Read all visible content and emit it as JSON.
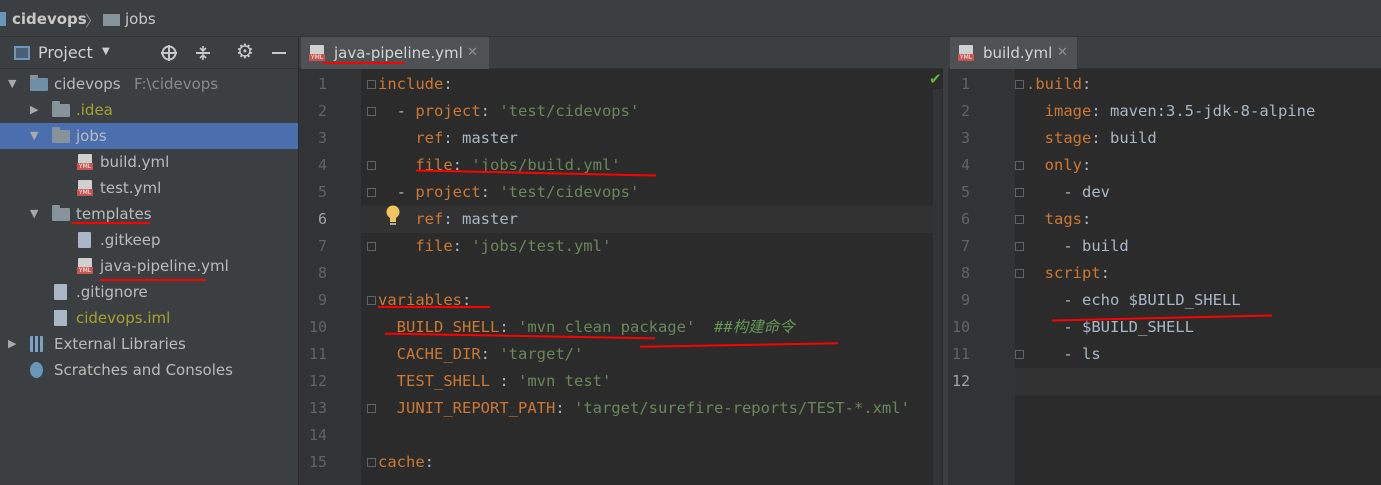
{
  "breadcrumb": {
    "root": "cidevops",
    "sep": "〉",
    "folder": "jobs"
  },
  "project_panel": {
    "header": {
      "view_label": "Project"
    },
    "tree": [
      {
        "label": "cidevops",
        "path": "F:\\cidevops",
        "kind": "module",
        "arrow": "▼",
        "level": 0
      },
      {
        "label": ".idea",
        "kind": "folder",
        "arrow": "▶",
        "level": 1,
        "color": "#a4a32f"
      },
      {
        "label": "jobs",
        "kind": "folder",
        "arrow": "▼",
        "level": 1,
        "selected": true
      },
      {
        "label": "build.yml",
        "kind": "yml",
        "level": 2
      },
      {
        "label": "test.yml",
        "kind": "yml",
        "level": 2
      },
      {
        "label": "templates",
        "kind": "folder",
        "arrow": "▼",
        "level": 1
      },
      {
        "label": ".gitkeep",
        "kind": "file",
        "level": 2
      },
      {
        "label": "java-pipeline.yml",
        "kind": "yml",
        "level": 2
      },
      {
        "label": ".gitignore",
        "kind": "file",
        "level": 1
      },
      {
        "label": "cidevops.iml",
        "kind": "file",
        "level": 1,
        "color": "#a4a32f"
      },
      {
        "label": "External Libraries",
        "kind": "lib",
        "arrow": "▶",
        "level": 0
      },
      {
        "label": "Scratches and Consoles",
        "kind": "scratch",
        "level": 0
      }
    ]
  },
  "editor_left": {
    "tab": {
      "label": "java-pipeline.yml",
      "close": "✕"
    },
    "current_line": 6,
    "lines": [
      {
        "n": "1",
        "t": [
          [
            "k",
            "include"
          ],
          [
            "p",
            ":"
          ]
        ]
      },
      {
        "n": "2",
        "t": [
          [
            "p",
            "  - "
          ],
          [
            "k",
            "project"
          ],
          [
            "p",
            ": "
          ],
          [
            "s",
            "'test/cidevops'"
          ]
        ]
      },
      {
        "n": "3",
        "t": [
          [
            "p",
            "    "
          ],
          [
            "k",
            "ref"
          ],
          [
            "p",
            ": master"
          ]
        ]
      },
      {
        "n": "4",
        "t": [
          [
            "p",
            "    "
          ],
          [
            "k",
            "file"
          ],
          [
            "p",
            ": "
          ],
          [
            "s",
            "'jobs/build.yml'"
          ]
        ]
      },
      {
        "n": "5",
        "t": [
          [
            "p",
            "  - "
          ],
          [
            "k",
            "project"
          ],
          [
            "p",
            ": "
          ],
          [
            "s",
            "'test/cidevops'"
          ]
        ]
      },
      {
        "n": "6",
        "t": [
          [
            "p",
            "    "
          ],
          [
            "k",
            "ref"
          ],
          [
            "p",
            ": master"
          ]
        ]
      },
      {
        "n": "7",
        "t": [
          [
            "p",
            "    "
          ],
          [
            "k",
            "file"
          ],
          [
            "p",
            ": "
          ],
          [
            "s",
            "'jobs/test.yml'"
          ]
        ]
      },
      {
        "n": "8",
        "t": []
      },
      {
        "n": "9",
        "t": [
          [
            "k",
            "variables"
          ],
          [
            "p",
            ":"
          ]
        ]
      },
      {
        "n": "10",
        "t": [
          [
            "p",
            "  "
          ],
          [
            "k",
            "BUILD_SHELL"
          ],
          [
            "p",
            ": "
          ],
          [
            "s",
            "'mvn clean package'"
          ],
          [
            "p",
            "  "
          ],
          [
            "c",
            "##构建命令"
          ]
        ]
      },
      {
        "n": "11",
        "t": [
          [
            "p",
            "  "
          ],
          [
            "k",
            "CACHE_DIR"
          ],
          [
            "p",
            ": "
          ],
          [
            "s",
            "'target/'"
          ]
        ]
      },
      {
        "n": "12",
        "t": [
          [
            "p",
            "  "
          ],
          [
            "k",
            "TEST_SHELL"
          ],
          [
            "p",
            " : "
          ],
          [
            "s",
            "'mvn test'"
          ]
        ]
      },
      {
        "n": "13",
        "t": [
          [
            "p",
            "  "
          ],
          [
            "k",
            "JUNIT_REPORT_PATH"
          ],
          [
            "p",
            ": "
          ],
          [
            "s",
            "'target/surefire-reports/TEST-*.xml'"
          ]
        ]
      },
      {
        "n": "14",
        "t": []
      },
      {
        "n": "15",
        "t": [
          [
            "k",
            "cache"
          ],
          [
            "p",
            ":"
          ]
        ]
      }
    ]
  },
  "editor_right": {
    "tab": {
      "label": "build.yml",
      "close": "✕"
    },
    "current_line": 12,
    "lines": [
      {
        "n": "1",
        "t": [
          [
            "k",
            ".build"
          ],
          [
            "p",
            ":"
          ]
        ]
      },
      {
        "n": "2",
        "t": [
          [
            "p",
            "  "
          ],
          [
            "k",
            "image"
          ],
          [
            "p",
            ": maven:3.5-jdk-8-alpine"
          ]
        ]
      },
      {
        "n": "3",
        "t": [
          [
            "p",
            "  "
          ],
          [
            "k",
            "stage"
          ],
          [
            "p",
            ": build"
          ]
        ]
      },
      {
        "n": "4",
        "t": [
          [
            "p",
            "  "
          ],
          [
            "k",
            "only"
          ],
          [
            "p",
            ":"
          ]
        ]
      },
      {
        "n": "5",
        "t": [
          [
            "p",
            "    - dev"
          ]
        ]
      },
      {
        "n": "6",
        "t": [
          [
            "p",
            "  "
          ],
          [
            "k",
            "tags"
          ],
          [
            "p",
            ":"
          ]
        ]
      },
      {
        "n": "7",
        "t": [
          [
            "p",
            "    - build"
          ]
        ]
      },
      {
        "n": "8",
        "t": [
          [
            "p",
            "  "
          ],
          [
            "k",
            "script"
          ],
          [
            "p",
            ":"
          ]
        ]
      },
      {
        "n": "9",
        "t": [
          [
            "p",
            "    - echo $BUILD_SHELL"
          ]
        ]
      },
      {
        "n": "10",
        "t": [
          [
            "p",
            "    - $BUILD_SHELL"
          ]
        ]
      },
      {
        "n": "11",
        "t": [
          [
            "p",
            "    - ls"
          ]
        ]
      },
      {
        "n": "12",
        "t": []
      }
    ]
  },
  "colors": {
    "keyword": "#cc7832",
    "string": "#6a8759",
    "selection": "#4b6eaf",
    "annotation": "#ff0000"
  }
}
